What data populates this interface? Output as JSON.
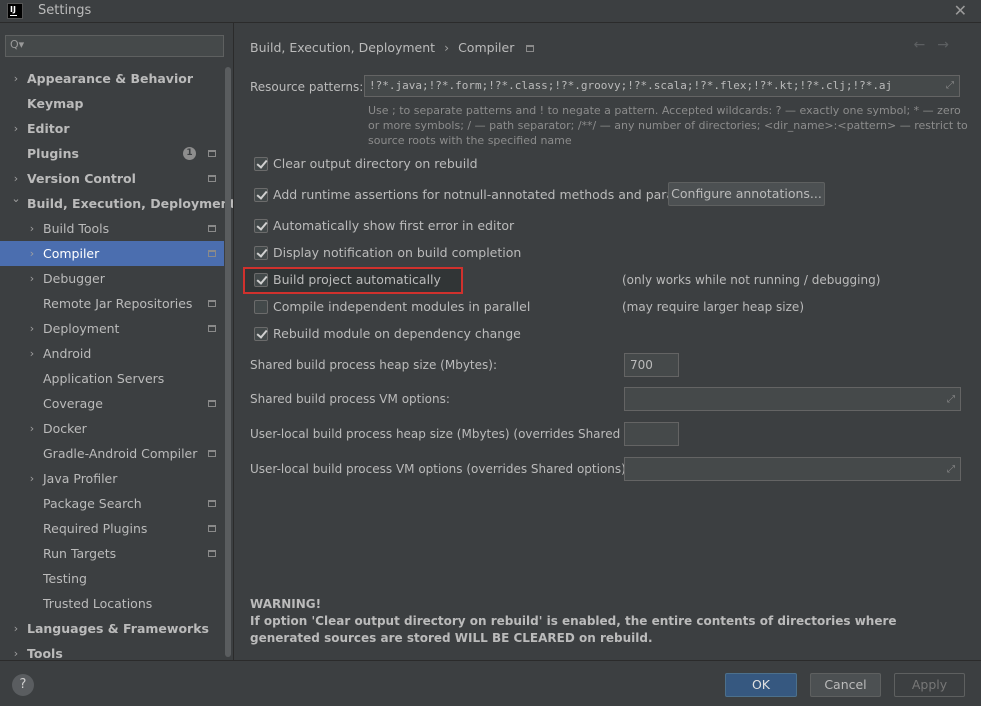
{
  "window": {
    "title": "Settings",
    "logo": "IJ",
    "close_icon": "close-icon"
  },
  "sidebar": {
    "search_placeholder": "",
    "items": [
      {
        "label": "Appearance & Behavior",
        "arrow": "›",
        "level": 0,
        "bold": true,
        "proj": false
      },
      {
        "label": "Keymap",
        "arrow": "",
        "level": 0,
        "bold": true,
        "proj": false
      },
      {
        "label": "Editor",
        "arrow": "›",
        "level": 0,
        "bold": true,
        "proj": false
      },
      {
        "label": "Plugins",
        "arrow": "",
        "level": 0,
        "bold": true,
        "proj": true,
        "badge": "1"
      },
      {
        "label": "Version Control",
        "arrow": "›",
        "level": 0,
        "bold": true,
        "proj": true
      },
      {
        "label": "Build, Execution, Deployment",
        "arrow": "⌄",
        "level": 0,
        "bold": true,
        "proj": false
      },
      {
        "label": "Build Tools",
        "arrow": "›",
        "level": 1,
        "bold": false,
        "proj": true
      },
      {
        "label": "Compiler",
        "arrow": "›",
        "level": 1,
        "bold": false,
        "proj": true,
        "selected": true
      },
      {
        "label": "Debugger",
        "arrow": "›",
        "level": 1,
        "bold": false,
        "proj": false
      },
      {
        "label": "Remote Jar Repositories",
        "arrow": "",
        "level": 1,
        "bold": false,
        "proj": true
      },
      {
        "label": "Deployment",
        "arrow": "›",
        "level": 1,
        "bold": false,
        "proj": true
      },
      {
        "label": "Android",
        "arrow": "›",
        "level": 1,
        "bold": false,
        "proj": false
      },
      {
        "label": "Application Servers",
        "arrow": "",
        "level": 1,
        "bold": false,
        "proj": false
      },
      {
        "label": "Coverage",
        "arrow": "",
        "level": 1,
        "bold": false,
        "proj": true
      },
      {
        "label": "Docker",
        "arrow": "›",
        "level": 1,
        "bold": false,
        "proj": false
      },
      {
        "label": "Gradle-Android Compiler",
        "arrow": "",
        "level": 1,
        "bold": false,
        "proj": true
      },
      {
        "label": "Java Profiler",
        "arrow": "›",
        "level": 1,
        "bold": false,
        "proj": false
      },
      {
        "label": "Package Search",
        "arrow": "",
        "level": 1,
        "bold": false,
        "proj": true
      },
      {
        "label": "Required Plugins",
        "arrow": "",
        "level": 1,
        "bold": false,
        "proj": true
      },
      {
        "label": "Run Targets",
        "arrow": "",
        "level": 1,
        "bold": false,
        "proj": true
      },
      {
        "label": "Testing",
        "arrow": "",
        "level": 1,
        "bold": false,
        "proj": false
      },
      {
        "label": "Trusted Locations",
        "arrow": "",
        "level": 1,
        "bold": false,
        "proj": false
      },
      {
        "label": "Languages & Frameworks",
        "arrow": "›",
        "level": 0,
        "bold": true,
        "proj": false
      },
      {
        "label": "Tools",
        "arrow": "›",
        "level": 0,
        "bold": true,
        "proj": false
      }
    ]
  },
  "main": {
    "breadcrumb": {
      "parent": "Build, Execution, Deployment",
      "sep": "›",
      "current": "Compiler"
    },
    "resource_patterns": {
      "label": "Resource patterns:",
      "value": "!?*.java;!?*.form;!?*.class;!?*.groovy;!?*.scala;!?*.flex;!?*.kt;!?*.clj;!?*.aj",
      "hint": "Use ; to separate patterns and ! to negate a pattern. Accepted wildcards: ? — exactly one symbol; * — zero or more symbols; / — path separator; /**/ — any number of directories; <dir_name>:<pattern> — restrict to source roots with the specified name"
    },
    "checkboxes": [
      {
        "label": "Clear output directory on rebuild",
        "checked": true
      },
      {
        "label": "Add runtime assertions for notnull-annotated methods and parameters",
        "checked": true
      },
      {
        "label": "Automatically show first error in editor",
        "checked": true
      },
      {
        "label": "Display notification on build completion",
        "checked": true
      },
      {
        "label": "Build project automatically",
        "checked": true,
        "note": "(only works while not running / debugging)"
      },
      {
        "label": "Compile independent modules in parallel",
        "checked": false,
        "note": "(may require larger heap size)"
      },
      {
        "label": "Rebuild module on dependency change",
        "checked": true
      }
    ],
    "configure_button": "Configure annotations...",
    "fields": [
      {
        "label": "Shared build process heap size (Mbytes):",
        "value": "700"
      },
      {
        "label": "Shared build process VM options:",
        "value": ""
      },
      {
        "label": "User-local build process heap size (Mbytes) (overrides Shared size):",
        "value": ""
      },
      {
        "label": "User-local build process VM options (overrides Shared options):",
        "value": ""
      }
    ],
    "warning": {
      "title": "WARNING!",
      "text": "If option 'Clear output directory on rebuild' is enabled, the entire contents of directories where generated sources are stored WILL BE CLEARED on rebuild."
    }
  },
  "footer": {
    "help": "?",
    "ok": "OK",
    "cancel": "Cancel",
    "apply": "Apply"
  },
  "colors": {
    "selection": "#4b6eaf",
    "highlight": "#d0312d",
    "ok_button": "#365880"
  }
}
